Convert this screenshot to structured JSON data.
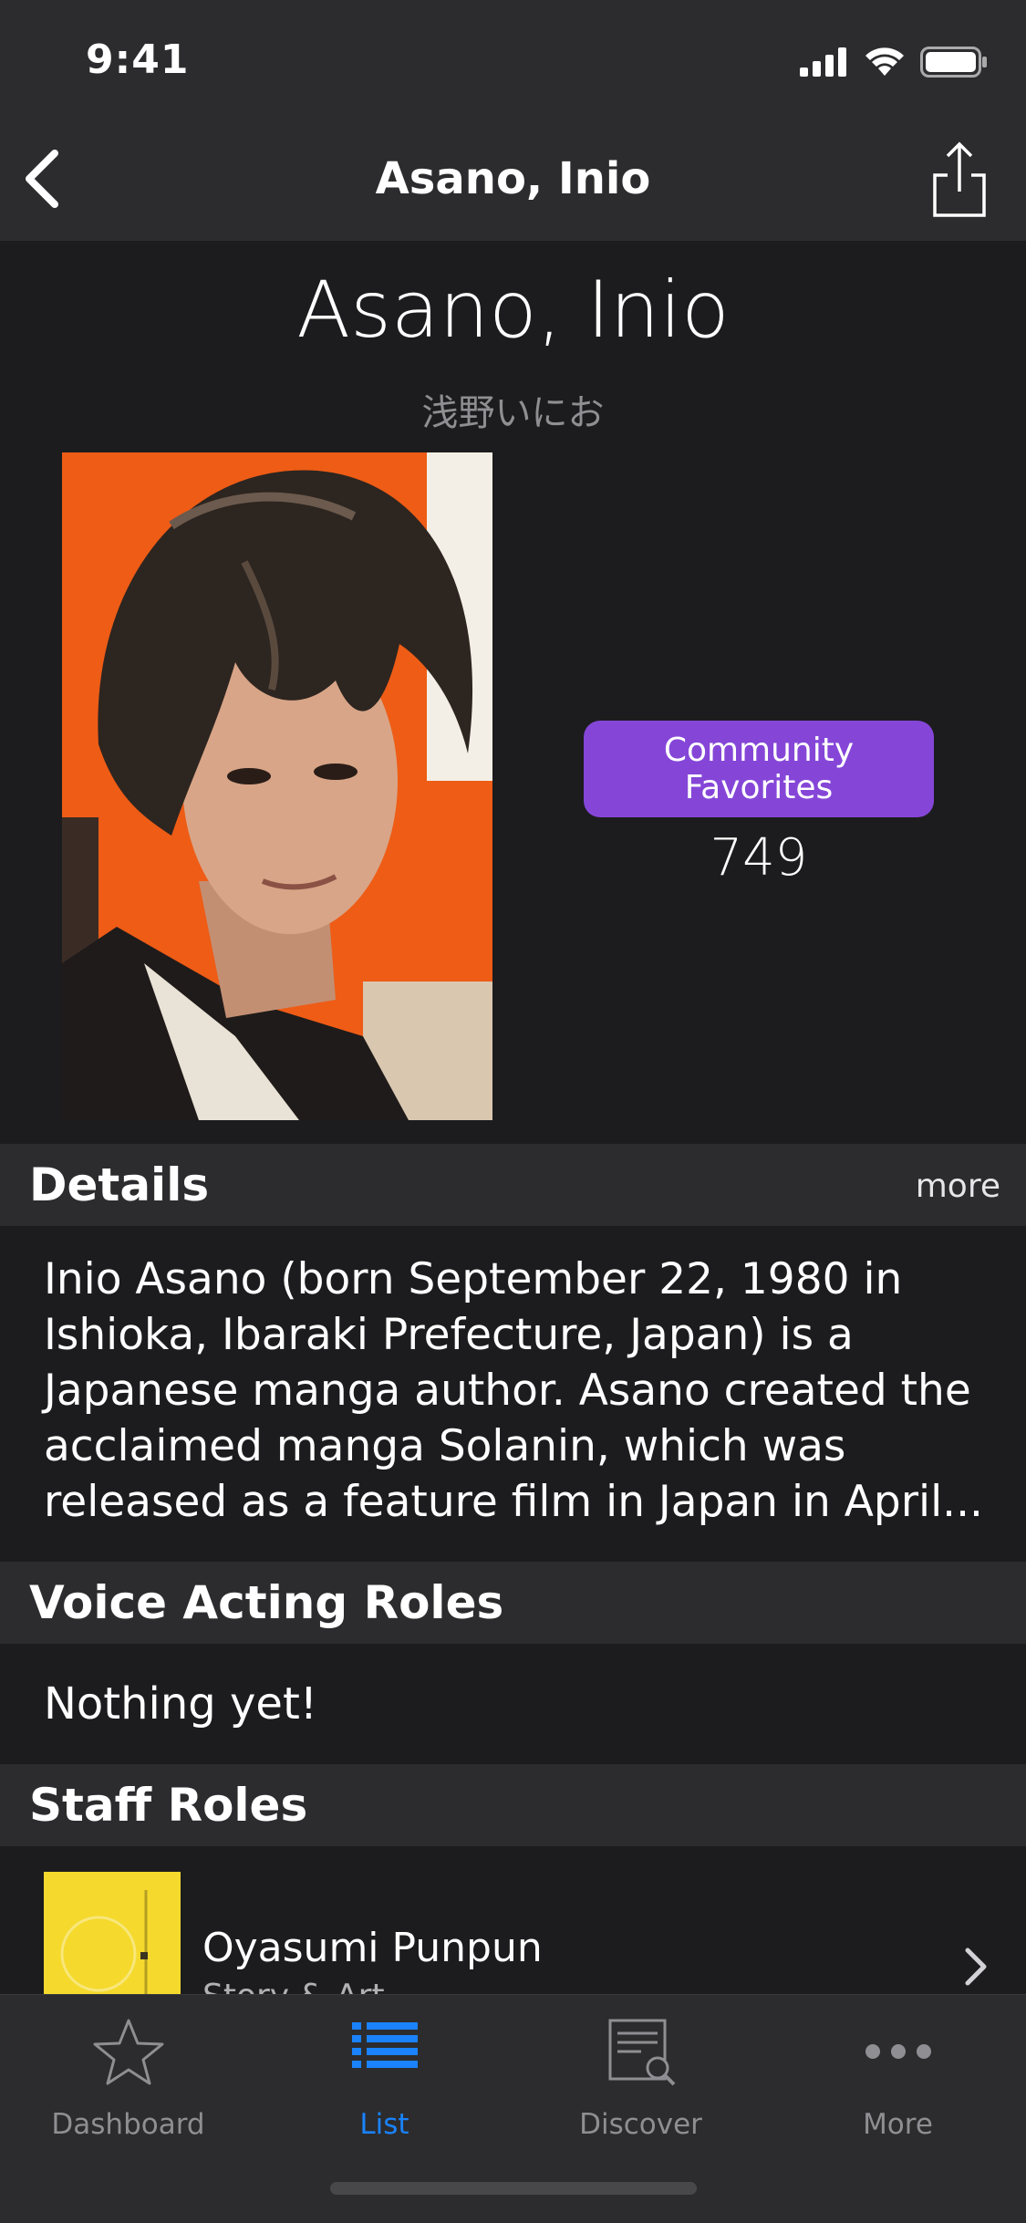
{
  "status_bar": {
    "time": "9:41"
  },
  "nav": {
    "title": "Asano, Inio"
  },
  "person": {
    "name": "Asano, Inio",
    "native_name": "浅野いにお",
    "favorites_label": "Community Favorites",
    "favorites_count": "749"
  },
  "sections": {
    "details": {
      "title": "Details",
      "more_label": "more",
      "text": "Inio Asano (born September 22, 1980 in Ishioka, Ibaraki Prefecture, Japan) is a Japanese manga author. Asano created the acclaimed manga Solanin, which was released as a feature film in Japan in April..."
    },
    "voice_acting": {
      "title": "Voice Acting Roles",
      "empty_text": "Nothing yet!"
    },
    "staff": {
      "title": "Staff Roles",
      "items": [
        {
          "title": "Oyasumi Punpun",
          "role": "Story & Art"
        }
      ]
    }
  },
  "tabbar": {
    "tabs": [
      {
        "label": "Dashboard",
        "icon": "star-icon",
        "active": false
      },
      {
        "label": "List",
        "icon": "list-icon",
        "active": true
      },
      {
        "label": "Discover",
        "icon": "discover-icon",
        "active": false
      },
      {
        "label": "More",
        "icon": "more-icon",
        "active": false
      }
    ]
  },
  "colors": {
    "background": "#1c1c1e",
    "bar": "#2c2c2e",
    "accent_blue": "#1a82fb",
    "favorites_badge": "#8546d8"
  }
}
